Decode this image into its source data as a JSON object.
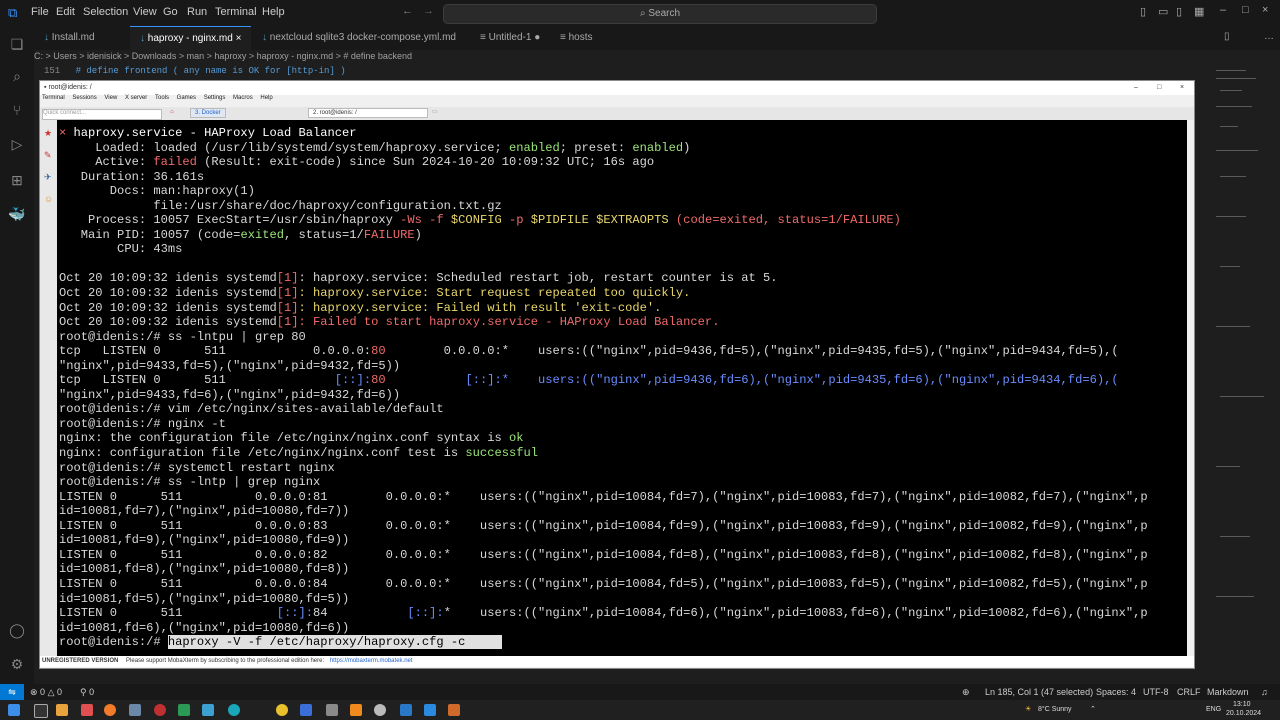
{
  "vscode": {
    "menu": [
      "File",
      "Edit",
      "Selection",
      "View",
      "Go",
      "Run",
      "Terminal",
      "Help"
    ],
    "search_placeholder": "Search",
    "tabs": [
      {
        "label": "Install.md"
      },
      {
        "label": "haproxy - nginx.md"
      },
      {
        "label": "nextcloud sqlite3 docker-compose.yml.md"
      },
      {
        "label": "Untitled-1"
      },
      {
        "label": "hosts"
      }
    ],
    "breadcrumb": "C: > Users > idenisick > Downloads > man > haproxy > haproxy - nginx.md > # define backend",
    "editor_line_number": "151",
    "editor_line_text": "# define frontend ( any name is OK for [http-in] )",
    "status": {
      "errors": "0",
      "warnings": "0",
      "ports": "0",
      "position": "Ln 185, Col 1 (47 selected)",
      "spaces": "Spaces: 4",
      "encoding": "UTF-8",
      "eol": "CRLF",
      "language": "Markdown"
    }
  },
  "moba": {
    "title": "root@idenis: /",
    "menu": [
      "Terminal",
      "Sessions",
      "View",
      "X server",
      "Tools",
      "Games",
      "Settings",
      "Macros",
      "Help"
    ],
    "quick_connect": "Quick connect...",
    "tabs": [
      {
        "label": "3. Docker"
      },
      {
        "label": "2. root@idenis: /"
      }
    ],
    "footer_unreg": "UNREGISTERED VERSION",
    "footer_text": "Please support MobaXterm by subscribing to the professional edition here:",
    "footer_link": "https://mobaxterm.mobatek.net"
  },
  "terminal": {
    "l01a": "× ",
    "l01b": "haproxy.service - HAProxy Load Balancer",
    "l02": "     Loaded: loaded (/usr/lib/systemd/system/haproxy.service; ",
    "l02g1": "enabled",
    "l02b": "; preset: ",
    "l02g2": "enabled",
    "l02c": ")",
    "l03a": "     Active: ",
    "l03r": "failed",
    "l03b": " (Result: exit-code) since Sun 2024-10-20 10:09:32 UTC; 16s ago",
    "l04": "   Duration: 36.161s",
    "l05": "       Docs: man:haproxy(1)",
    "l06": "             file:/usr/share/doc/haproxy/configuration.txt.gz",
    "l07a": "    Process: 10057 ExecStart=/usr/sbin/haproxy ",
    "l07r1": "-Ws -f ",
    "l07y1": "$CONFIG",
    "l07r2": " -p ",
    "l07y2": "$PIDFILE $EXTRAOPTS",
    "l07r3": " (code=exited, status=1/FAILURE)",
    "l08a": "   Main PID: 10057 (code=",
    "l08g": "exited",
    "l08b": ", status=1/",
    "l08r": "FAILURE",
    "l08c": ")",
    "l09": "        CPU: 43ms",
    "l11a": "Oct 20 10:09:32 idenis systemd",
    "l11r": "[1]",
    "l11b": ": haproxy.service: Scheduled restart job, restart counter is at 5.",
    "l12a": "Oct 20 10:09:32 idenis systemd",
    "l12r": "[1]",
    "l12y": ": haproxy.service: Start request repeated too quickly.",
    "l13a": "Oct 20 10:09:32 idenis systemd",
    "l13r": "[1]",
    "l13y": ": haproxy.service: Failed with result 'exit-code'.",
    "l14a": "Oct 20 10:09:32 idenis systemd",
    "l14r1": "[1]",
    "l14r2": ": Failed to start haproxy.service - HAProxy Load Balancer.",
    "l15": "root@idenis:/# ss -lntpu | grep 80",
    "l16a": "tcp   LISTEN 0      511            0.0.0.0:",
    "l16r": "80",
    "l16b": "        0.0.0.0:*    users:((\"nginx\",pid=9436,fd=5),(\"nginx\",pid=9435,fd=5),(\"nginx\",pid=9434,fd=5),(",
    "l17": "\"nginx\",pid=9433,fd=5),(\"nginx\",pid=9432,fd=5))",
    "l18a": "tcp   LISTEN 0      511               ",
    "l18b": "[::]:",
    "l18r": "80",
    "l18c": "           [::]:*    users:((\"nginx\",pid=9436,fd=6),(\"nginx\",pid=9435,fd=6),(\"nginx\",pid=9434,fd=6),(",
    "l19": "\"nginx\",pid=9433,fd=6),(\"nginx\",pid=9432,fd=6))",
    "l20": "root@idenis:/# vim /etc/nginx/sites-available/default",
    "l21": "root@idenis:/# nginx -t",
    "l22a": "nginx: the configuration file /etc/nginx/nginx.conf syntax is ",
    "l22g": "ok",
    "l23a": "nginx: configuration file /etc/nginx/nginx.conf test is ",
    "l23g": "successful",
    "l24": "root@idenis:/# systemctl restart nginx",
    "l25": "root@idenis:/# ss -lntp | grep nginx",
    "l26": "LISTEN 0      511          0.0.0.0:81        0.0.0.0:*    users:((\"nginx\",pid=10084,fd=7),(\"nginx\",pid=10083,fd=7),(\"nginx\",pid=10082,fd=7),(\"nginx\",p",
    "l27": "id=10081,fd=7),(\"nginx\",pid=10080,fd=7))",
    "l28": "LISTEN 0      511          0.0.0.0:83        0.0.0.0:*    users:((\"nginx\",pid=10084,fd=9),(\"nginx\",pid=10083,fd=9),(\"nginx\",pid=10082,fd=9),(\"nginx\",p",
    "l29": "id=10081,fd=9),(\"nginx\",pid=10080,fd=9))",
    "l30": "LISTEN 0      511          0.0.0.0:82        0.0.0.0:*    users:((\"nginx\",pid=10084,fd=8),(\"nginx\",pid=10083,fd=8),(\"nginx\",pid=10082,fd=8),(\"nginx\",p",
    "l31": "id=10081,fd=8),(\"nginx\",pid=10080,fd=8))",
    "l32": "LISTEN 0      511          0.0.0.0:84        0.0.0.0:*    users:((\"nginx\",pid=10084,fd=5),(\"nginx\",pid=10083,fd=5),(\"nginx\",pid=10082,fd=5),(\"nginx\",p",
    "l33": "id=10081,fd=5),(\"nginx\",pid=10080,fd=5))",
    "l34a": "LISTEN 0      511             ",
    "l34b": "[::]:",
    "l34c": "84           ",
    "l34d": "[::]:",
    "l34e": "*    users:((\"nginx\",pid=10084,fd=6),(\"nginx\",pid=10083,fd=6),(\"nginx\",pid=10082,fd=6),(\"nginx\",p",
    "l35": "id=10081,fd=6),(\"nginx\",pid=10080,fd=6))",
    "prompt": "root@idenis:/# ",
    "command": "haproxy -V -f /etc/haproxy/haproxy.cfg -c"
  },
  "taskbar": {
    "weather": "8°C  Sunny",
    "lang": "ENG",
    "time": "13:10",
    "date": "20.10.2024"
  },
  "colors": {
    "vscode_accent": "#3794ff",
    "term_red": "#f06a6a",
    "term_green": "#9be57a",
    "term_yellow": "#e8d66a"
  }
}
